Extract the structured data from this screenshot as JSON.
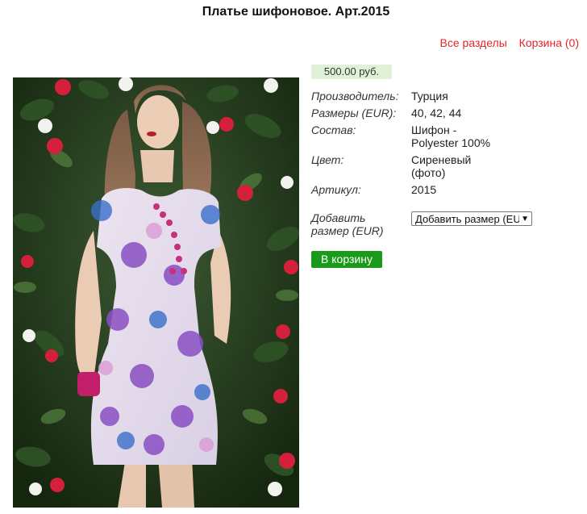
{
  "page": {
    "title": "Платье шифоновое. Арт.2015"
  },
  "nav": {
    "all_sections": "Все разделы",
    "cart": "Корзина (0)"
  },
  "product": {
    "price": "500.00 руб.",
    "properties": [
      {
        "label": "Производитель:",
        "value": "Турция"
      },
      {
        "label": "Размеры (EUR):",
        "value": "40, 42, 44"
      },
      {
        "label": "Состав:",
        "value": "Шифон -\nPolyester 100%"
      },
      {
        "label": "Цвет:",
        "value": "Сиреневый\n(фото)"
      },
      {
        "label": "Артикул:",
        "value": "2015"
      }
    ],
    "add_size_label": "Добавить\nразмер (EUR)",
    "size_select_value": "Добавить размер (EU",
    "cart_button": "В корзину"
  },
  "colors": {
    "nav_link": "#e0262a",
    "price_bg": "#dff2d8",
    "cart_button_bg": "#1a9a1a"
  }
}
